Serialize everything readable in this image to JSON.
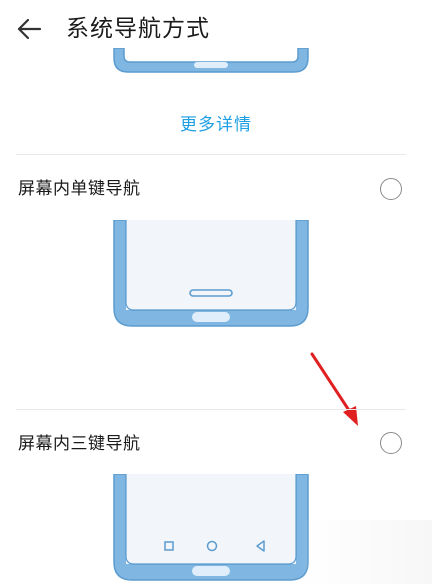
{
  "header": {
    "title": "系统导航方式",
    "back_icon": "arrow-left-icon"
  },
  "more_details": "更多详情",
  "options": [
    {
      "label": "屏幕内单键导航",
      "selected": false,
      "preview": "phone-single-key-preview"
    },
    {
      "label": "屏幕内三键导航",
      "selected": false,
      "preview": "phone-three-key-preview"
    }
  ],
  "colors": {
    "accent": "#1e9fe3",
    "phone_frame": "#7fb6e2",
    "phone_screen": "#f2f6fb",
    "annotation_arrow": "#e02020"
  }
}
